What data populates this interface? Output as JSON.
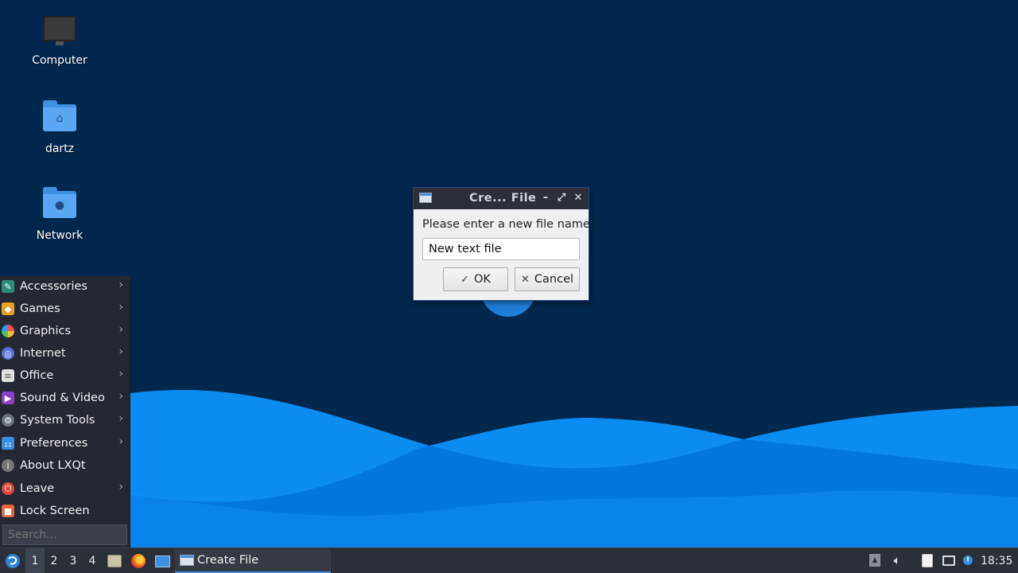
{
  "desktop": {
    "icons": [
      {
        "label": "Computer",
        "icon": "computer-icon"
      },
      {
        "label": "dartz",
        "icon": "home-folder-icon"
      },
      {
        "label": "Network",
        "icon": "network-folder-icon"
      }
    ]
  },
  "menu": {
    "items": [
      {
        "label": "Accessories",
        "icon": "accessories-icon",
        "submenu": true
      },
      {
        "label": "Games",
        "icon": "games-icon",
        "submenu": true
      },
      {
        "label": "Graphics",
        "icon": "graphics-icon",
        "submenu": true
      },
      {
        "label": "Internet",
        "icon": "internet-icon",
        "submenu": true
      },
      {
        "label": "Office",
        "icon": "office-icon",
        "submenu": true
      },
      {
        "label": "Sound & Video",
        "icon": "sound-video-icon",
        "submenu": true
      },
      {
        "label": "System Tools",
        "icon": "system-tools-icon",
        "submenu": true
      },
      {
        "label": "Preferences",
        "icon": "preferences-icon",
        "submenu": true
      },
      {
        "label": "About LXQt",
        "icon": "info-icon",
        "submenu": false
      },
      {
        "label": "Leave",
        "icon": "power-icon",
        "submenu": true
      },
      {
        "label": "Lock Screen",
        "icon": "lock-icon",
        "submenu": false
      }
    ],
    "search_placeholder": "Search..."
  },
  "dialog": {
    "title": "Cre... File",
    "prompt": "Please enter a new file name:",
    "input_value": "New text file",
    "ok_label": "OK",
    "cancel_label": "Cancel"
  },
  "taskbar": {
    "desktops": [
      "1",
      "2",
      "3",
      "4"
    ],
    "active_desktop": "1",
    "task_label": "Create File",
    "clock": "18:35"
  },
  "colors": {
    "desktop_bg": "#00284f",
    "wave_light": "#0a8cf0",
    "wave_mid": "#0077dd",
    "accent": "#3b8ee6",
    "panel_bg": "#2b2f38"
  }
}
